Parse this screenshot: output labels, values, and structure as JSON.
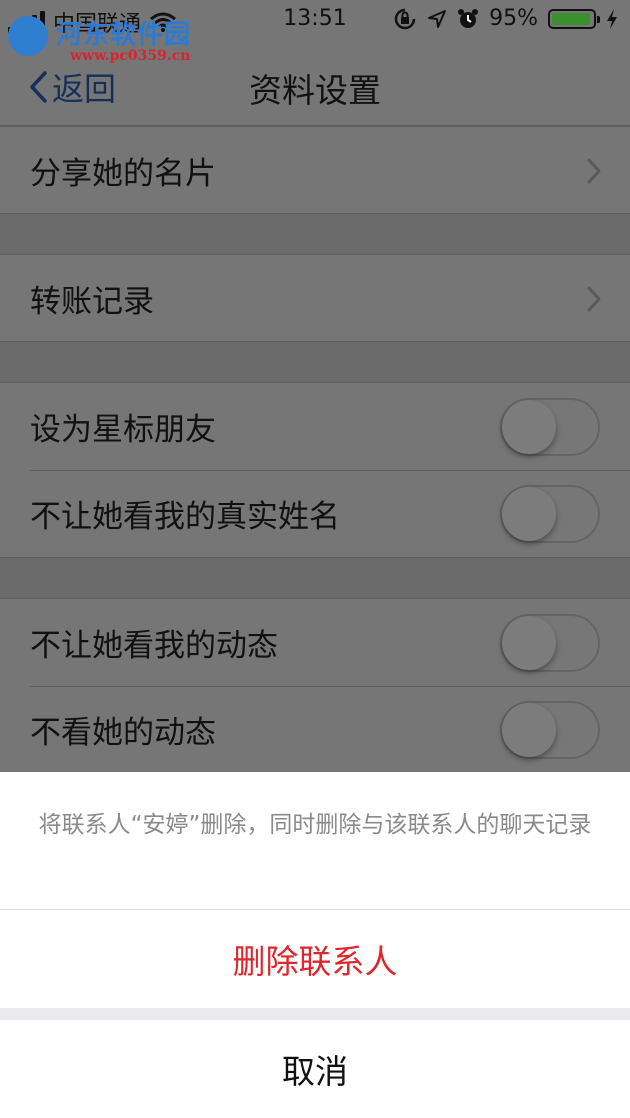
{
  "status_bar": {
    "carrier": "中国联通",
    "time": "13:51",
    "battery_percent": "95%",
    "battery_level": 0.95,
    "icons": [
      "signal-icon",
      "wifi-icon",
      "orientation-lock-icon",
      "location-icon",
      "alarm-icon",
      "battery-icon",
      "charging-icon"
    ]
  },
  "watermark": {
    "site_name": "河东软件园",
    "site_url": "www.pc0359.cn"
  },
  "nav": {
    "back_label": "返回",
    "title": "资料设置"
  },
  "settings": {
    "share_card": "分享她的名片",
    "transfer_records": "转账记录",
    "star_friend": {
      "label": "设为星标朋友",
      "on": false
    },
    "hide_real_name": {
      "label": "不让她看我的真实姓名",
      "on": false
    },
    "hide_my_moments": {
      "label": "不让她看我的动态",
      "on": false
    },
    "hide_her_moments": {
      "label": "不看她的动态",
      "on": false
    }
  },
  "action_sheet": {
    "message": "将联系人“安婷”删除，同时删除与该联系人的聊天记录",
    "delete_label": "删除联系人",
    "cancel_label": "取消",
    "delete_color": "#e0262d"
  }
}
